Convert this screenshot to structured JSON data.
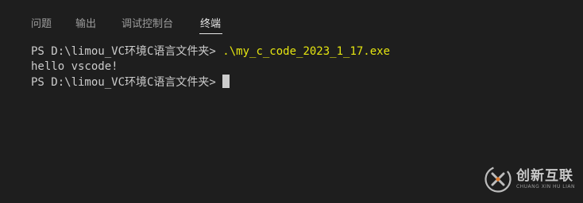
{
  "tabs": [
    {
      "label": "问题",
      "active": false
    },
    {
      "label": "输出",
      "active": false
    },
    {
      "label": "调试控制台",
      "active": false
    },
    {
      "label": "终端",
      "active": true
    }
  ],
  "terminal": {
    "prompt": "PS D:\\limou_VC环境C语言文件夹>",
    "command": ".\\my_c_code_2023_1_17.exe",
    "output": "hello vscode!",
    "prompt2": "PS D:\\limou_VC环境C语言文件夹>"
  },
  "watermark": {
    "cn": "创新互联",
    "en": "CHUANG XIN HU LIAN"
  },
  "colors": {
    "background": "#1e1e1e",
    "text": "#cccccc",
    "command": "#e5e510",
    "tab_inactive": "#9d9d9d",
    "tab_active": "#e7e7e7"
  }
}
